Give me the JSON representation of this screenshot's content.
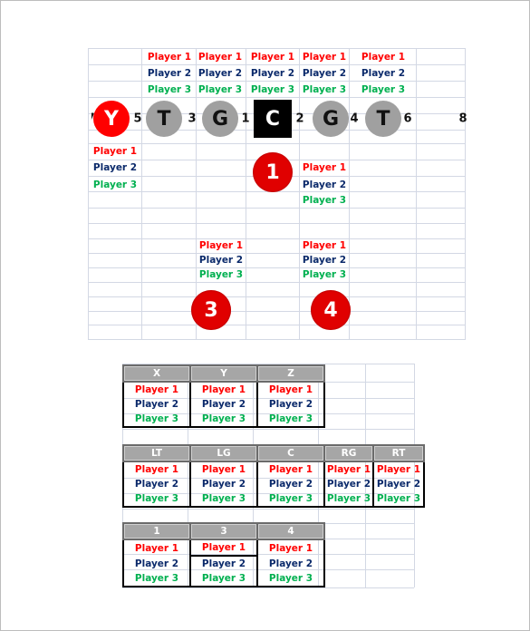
{
  "formation": {
    "gap_numbers": [
      "7",
      "5",
      "3",
      "1",
      "2",
      "4",
      "6",
      "8"
    ],
    "linemen": [
      {
        "label": "Y",
        "style": "red-circle"
      },
      {
        "label": "T",
        "style": "gray-circle"
      },
      {
        "label": "G",
        "style": "gray-circle"
      },
      {
        "label": "C",
        "style": "black-square"
      },
      {
        "label": "G",
        "style": "gray-circle"
      },
      {
        "label": "T",
        "style": "gray-circle"
      }
    ],
    "backs": [
      {
        "label": "1",
        "style": "red-circle"
      },
      {
        "label": "3",
        "style": "red-circle"
      },
      {
        "label": "4",
        "style": "red-circle"
      }
    ],
    "player_labels": [
      "Player 1",
      "Player 2",
      "Player 3"
    ],
    "colors": {
      "player1": "#ff0000",
      "player2": "#0b2a6b",
      "player3": "#00b050",
      "lineman": "#a0a0a0",
      "center": "#000000",
      "back": "#ff0000"
    }
  },
  "tables": [
    {
      "name": "receivers",
      "headers": [
        "X",
        "Y",
        "Z"
      ],
      "rows": [
        [
          "Player 1",
          "Player 1",
          "Player 1"
        ],
        [
          "Player 2",
          "Player 2",
          "Player 2"
        ],
        [
          "Player 3",
          "Player 3",
          "Player 3"
        ]
      ]
    },
    {
      "name": "offensive-line",
      "headers": [
        "LT",
        "LG",
        "C",
        "RG",
        "RT"
      ],
      "rows": [
        [
          "Player 1",
          "Player 1",
          "Player 1",
          "Player 1",
          "Player 1"
        ],
        [
          "Player 2",
          "Player 2",
          "Player 2",
          "Player 2",
          "Player 2"
        ],
        [
          "Player 3",
          "Player 3",
          "Player 3",
          "Player 3",
          "Player 3"
        ]
      ]
    },
    {
      "name": "backs",
      "headers": [
        "1",
        "3",
        "4"
      ],
      "rows": [
        [
          "Player 1",
          "Player 1",
          "Player 1"
        ],
        [
          "Player 2",
          "Player 2",
          "Player 2"
        ],
        [
          "Player 3",
          "Player 3",
          "Player 3"
        ]
      ]
    }
  ]
}
